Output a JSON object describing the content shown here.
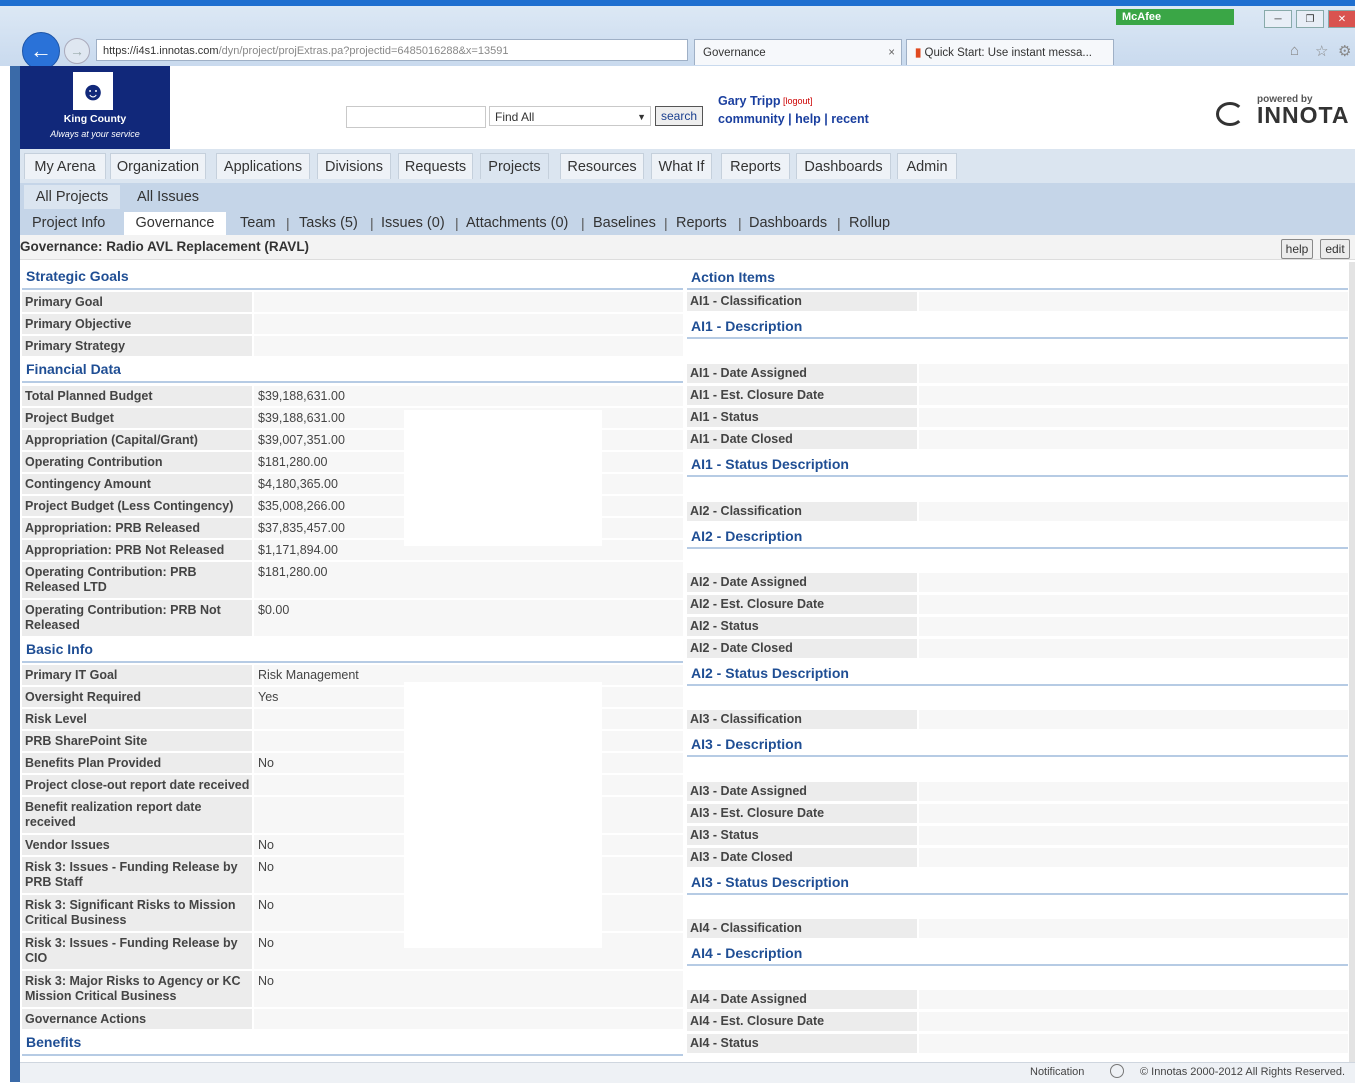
{
  "browser": {
    "url_main": "https://i4s1.innotas.com",
    "url_rest": "/dyn/project/projExtras.pa?projectid=6485016288&x=13591",
    "tabs": [
      {
        "label": "Governance"
      },
      {
        "label": "Quick Start: Use instant messa..."
      }
    ],
    "mcafee": "McAfee",
    "back_icon": "arrow-left-icon",
    "colors": {
      "frame": "#1e6fd0",
      "mcafee": "#3aa646"
    }
  },
  "header": {
    "logo_name": "King County",
    "logo_tagline": "Always at your service",
    "search_select": "Find All",
    "search_button": "search",
    "user": "Gary Tripp",
    "logout": "[logout]",
    "links": "community | help | recent",
    "powered_by": "powered by",
    "brand": "INNOTA"
  },
  "nav": {
    "tabs": [
      "My Arena",
      "Organization",
      "Applications",
      "Divisions",
      "Requests",
      "Projects",
      "Resources",
      "What If",
      "Reports",
      "Dashboards",
      "Admin"
    ],
    "sub": [
      "All Projects",
      "All Issues"
    ],
    "project_tabs": [
      "Project Info",
      "Governance",
      "Team",
      "Tasks (5)",
      "Issues (0)",
      "Attachments (0)",
      "Baselines",
      "Reports",
      "Dashboards",
      "Rollup"
    ]
  },
  "page": {
    "title": "Governance: Radio AVL Replacement (RAVL)",
    "help": "help",
    "edit": "edit"
  },
  "strategic": {
    "header": "Strategic Goals",
    "rows": [
      {
        "label": "Primary Goal",
        "value": ""
      },
      {
        "label": "Primary Objective",
        "value": ""
      },
      {
        "label": "Primary Strategy",
        "value": ""
      }
    ]
  },
  "financial": {
    "header": "Financial Data",
    "rows": [
      {
        "label": "Total Planned Budget",
        "value": "$39,188,631.00"
      },
      {
        "label": "Project Budget",
        "value": "$39,188,631.00"
      },
      {
        "label": "Appropriation (Capital/Grant)",
        "value": "$39,007,351.00"
      },
      {
        "label": "Operating Contribution",
        "value": "$181,280.00"
      },
      {
        "label": "Contingency Amount",
        "value": "$4,180,365.00"
      },
      {
        "label": "Project Budget (Less Contingency)",
        "value": "$35,008,266.00"
      },
      {
        "label": "Appropriation: PRB Released",
        "value": "$37,835,457.00"
      },
      {
        "label": "Appropriation: PRB Not Released",
        "value": "$1,171,894.00"
      },
      {
        "label": "Operating Contribution: PRB Released LTD",
        "value": "$181,280.00"
      },
      {
        "label": "Operating Contribution: PRB Not Released",
        "value": "$0.00"
      }
    ]
  },
  "basic": {
    "header": "Basic Info",
    "rows": [
      {
        "label": "Primary IT Goal",
        "value": "Risk Management"
      },
      {
        "label": "Oversight Required",
        "value": "Yes"
      },
      {
        "label": "Risk Level",
        "value": ""
      },
      {
        "label": "PRB SharePoint Site",
        "value": ""
      },
      {
        "label": "Benefits Plan Provided",
        "value": "No"
      },
      {
        "label": "Project close-out report date received",
        "value": ""
      },
      {
        "label": "Benefit realization report date received",
        "value": ""
      },
      {
        "label": "Vendor Issues",
        "value": "No"
      },
      {
        "label": "Risk 3: Issues - Funding Release by PRB Staff",
        "value": "No"
      },
      {
        "label": "Risk 3: Significant Risks to Mission Critical Business",
        "value": "No"
      },
      {
        "label": "Risk 3: Issues - Funding Release by CIO",
        "value": "No"
      },
      {
        "label": "Risk 3: Major Risks to Agency or KC Mission Critical Business",
        "value": "No"
      },
      {
        "label": "Governance Actions",
        "value": ""
      }
    ]
  },
  "benefits": {
    "header": "Benefits"
  },
  "actions": {
    "header": "Action Items",
    "ai1": {
      "classification": "AI1 - Classification",
      "description": "AI1 - Description",
      "date_assigned": "AI1 - Date Assigned",
      "closure": "AI1 - Est. Closure Date",
      "status": "AI1 - Status",
      "date_closed": "AI1 - Date Closed",
      "status_desc": "AI1 - Status Description"
    },
    "ai2": {
      "classification": "AI2 - Classification",
      "description": "AI2 - Description",
      "date_assigned": "AI2 - Date Assigned",
      "closure": "AI2 - Est. Closure Date",
      "status": "AI2 - Status",
      "date_closed": "AI2 - Date Closed",
      "status_desc": "AI2 - Status Description"
    },
    "ai3": {
      "classification": "AI3 - Classification",
      "description": "AI3 - Description",
      "date_assigned": "AI3 - Date Assigned",
      "closure": "AI3 - Est. Closure Date",
      "status": "AI3 - Status",
      "date_closed": "AI3 - Date Closed",
      "status_desc": "AI3 - Status Description"
    },
    "ai4": {
      "classification": "AI4 - Classification",
      "description": "AI4 - Description",
      "date_assigned": "AI4 - Date Assigned",
      "closure": "AI4 - Est. Closure Date",
      "status": "AI4 - Status"
    }
  },
  "status_bar": {
    "notification": "Notification",
    "copyright": "© Innotas 2000-2012 All Rights Reserved."
  }
}
